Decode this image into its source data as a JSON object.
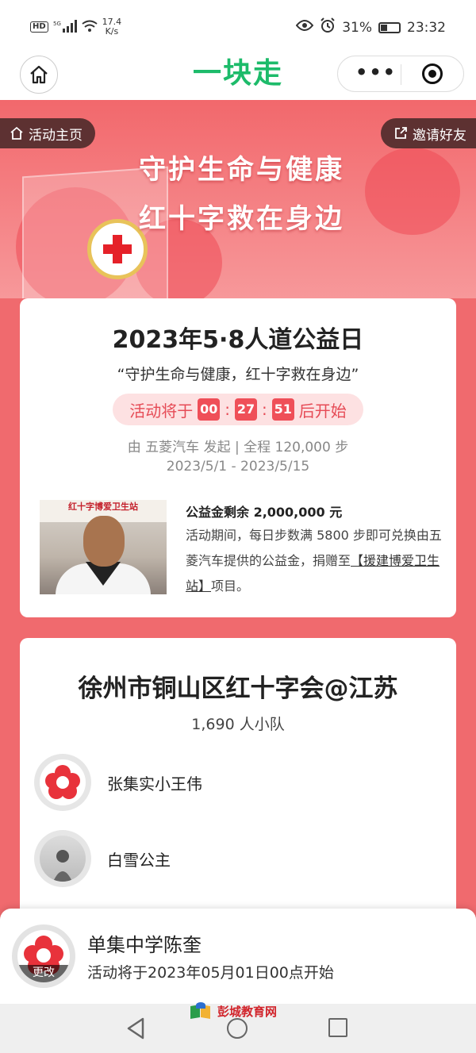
{
  "status_bar": {
    "hd": "HD",
    "net_type": "5G",
    "speed_value": "17.4",
    "speed_unit": "K/s",
    "battery": "31%",
    "time": "23:32"
  },
  "nav": {
    "title": "一块走"
  },
  "banner": {
    "home_label": "活动主页",
    "invite_label": "邀请好友",
    "line1": "守护生命与健康",
    "line2": "红十字救在身边"
  },
  "event": {
    "title": "2023年5·8人道公益日",
    "slogan": "“守护生命与健康，红十字救在身边”",
    "countdown": {
      "prefix": "活动将于",
      "hours": "00",
      "minutes": "27",
      "seconds": "51",
      "suffix": "后开始",
      "sep": ":"
    },
    "sponsor_line": "由 五菱汽车 发起 | 全程 120,000 步",
    "date_range": "2023/5/1 - 2023/5/15",
    "photo_sign": "红十字博爱卫生站",
    "fund_heading": "公益金剩余 2,000,000 元",
    "desc_part1": "活动期间，每日步数满 5800 步即可兑换由五菱汽车提供的公益金，捐赠至",
    "project_link": "【援建博爱卫生站】",
    "desc_part2": "项目。"
  },
  "team": {
    "name": "徐州市铜山区红十字会@江苏",
    "size": "1,690 人小队",
    "members": [
      {
        "name": "张集实小王伟"
      },
      {
        "name": "白雪公主"
      }
    ]
  },
  "me": {
    "change_label": "更改",
    "name": "单集中学陈奎",
    "note": "活动将于2023年05月01日00点开始"
  },
  "watermark": {
    "text": "彭城教育网"
  }
}
